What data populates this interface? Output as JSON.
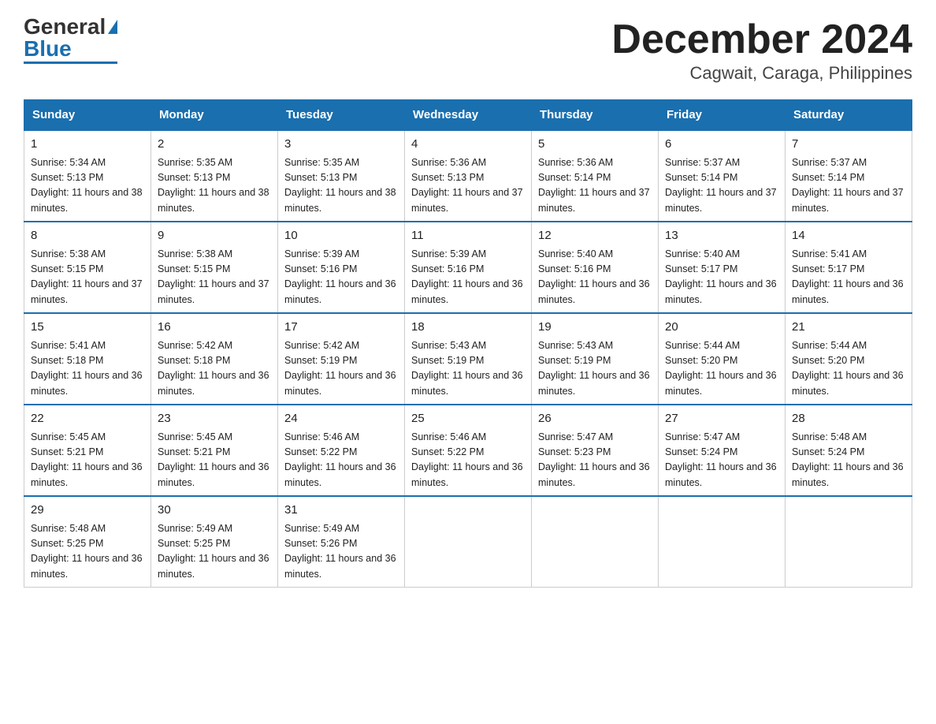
{
  "logo": {
    "general": "General",
    "blue": "Blue"
  },
  "title": "December 2024",
  "subtitle": "Cagwait, Caraga, Philippines",
  "days_of_week": [
    "Sunday",
    "Monday",
    "Tuesday",
    "Wednesday",
    "Thursday",
    "Friday",
    "Saturday"
  ],
  "weeks": [
    [
      {
        "day": "1",
        "sunrise": "5:34 AM",
        "sunset": "5:13 PM",
        "daylight": "11 hours and 38 minutes."
      },
      {
        "day": "2",
        "sunrise": "5:35 AM",
        "sunset": "5:13 PM",
        "daylight": "11 hours and 38 minutes."
      },
      {
        "day": "3",
        "sunrise": "5:35 AM",
        "sunset": "5:13 PM",
        "daylight": "11 hours and 38 minutes."
      },
      {
        "day": "4",
        "sunrise": "5:36 AM",
        "sunset": "5:13 PM",
        "daylight": "11 hours and 37 minutes."
      },
      {
        "day": "5",
        "sunrise": "5:36 AM",
        "sunset": "5:14 PM",
        "daylight": "11 hours and 37 minutes."
      },
      {
        "day": "6",
        "sunrise": "5:37 AM",
        "sunset": "5:14 PM",
        "daylight": "11 hours and 37 minutes."
      },
      {
        "day": "7",
        "sunrise": "5:37 AM",
        "sunset": "5:14 PM",
        "daylight": "11 hours and 37 minutes."
      }
    ],
    [
      {
        "day": "8",
        "sunrise": "5:38 AM",
        "sunset": "5:15 PM",
        "daylight": "11 hours and 37 minutes."
      },
      {
        "day": "9",
        "sunrise": "5:38 AM",
        "sunset": "5:15 PM",
        "daylight": "11 hours and 37 minutes."
      },
      {
        "day": "10",
        "sunrise": "5:39 AM",
        "sunset": "5:16 PM",
        "daylight": "11 hours and 36 minutes."
      },
      {
        "day": "11",
        "sunrise": "5:39 AM",
        "sunset": "5:16 PM",
        "daylight": "11 hours and 36 minutes."
      },
      {
        "day": "12",
        "sunrise": "5:40 AM",
        "sunset": "5:16 PM",
        "daylight": "11 hours and 36 minutes."
      },
      {
        "day": "13",
        "sunrise": "5:40 AM",
        "sunset": "5:17 PM",
        "daylight": "11 hours and 36 minutes."
      },
      {
        "day": "14",
        "sunrise": "5:41 AM",
        "sunset": "5:17 PM",
        "daylight": "11 hours and 36 minutes."
      }
    ],
    [
      {
        "day": "15",
        "sunrise": "5:41 AM",
        "sunset": "5:18 PM",
        "daylight": "11 hours and 36 minutes."
      },
      {
        "day": "16",
        "sunrise": "5:42 AM",
        "sunset": "5:18 PM",
        "daylight": "11 hours and 36 minutes."
      },
      {
        "day": "17",
        "sunrise": "5:42 AM",
        "sunset": "5:19 PM",
        "daylight": "11 hours and 36 minutes."
      },
      {
        "day": "18",
        "sunrise": "5:43 AM",
        "sunset": "5:19 PM",
        "daylight": "11 hours and 36 minutes."
      },
      {
        "day": "19",
        "sunrise": "5:43 AM",
        "sunset": "5:19 PM",
        "daylight": "11 hours and 36 minutes."
      },
      {
        "day": "20",
        "sunrise": "5:44 AM",
        "sunset": "5:20 PM",
        "daylight": "11 hours and 36 minutes."
      },
      {
        "day": "21",
        "sunrise": "5:44 AM",
        "sunset": "5:20 PM",
        "daylight": "11 hours and 36 minutes."
      }
    ],
    [
      {
        "day": "22",
        "sunrise": "5:45 AM",
        "sunset": "5:21 PM",
        "daylight": "11 hours and 36 minutes."
      },
      {
        "day": "23",
        "sunrise": "5:45 AM",
        "sunset": "5:21 PM",
        "daylight": "11 hours and 36 minutes."
      },
      {
        "day": "24",
        "sunrise": "5:46 AM",
        "sunset": "5:22 PM",
        "daylight": "11 hours and 36 minutes."
      },
      {
        "day": "25",
        "sunrise": "5:46 AM",
        "sunset": "5:22 PM",
        "daylight": "11 hours and 36 minutes."
      },
      {
        "day": "26",
        "sunrise": "5:47 AM",
        "sunset": "5:23 PM",
        "daylight": "11 hours and 36 minutes."
      },
      {
        "day": "27",
        "sunrise": "5:47 AM",
        "sunset": "5:24 PM",
        "daylight": "11 hours and 36 minutes."
      },
      {
        "day": "28",
        "sunrise": "5:48 AM",
        "sunset": "5:24 PM",
        "daylight": "11 hours and 36 minutes."
      }
    ],
    [
      {
        "day": "29",
        "sunrise": "5:48 AM",
        "sunset": "5:25 PM",
        "daylight": "11 hours and 36 minutes."
      },
      {
        "day": "30",
        "sunrise": "5:49 AM",
        "sunset": "5:25 PM",
        "daylight": "11 hours and 36 minutes."
      },
      {
        "day": "31",
        "sunrise": "5:49 AM",
        "sunset": "5:26 PM",
        "daylight": "11 hours and 36 minutes."
      },
      null,
      null,
      null,
      null
    ]
  ]
}
